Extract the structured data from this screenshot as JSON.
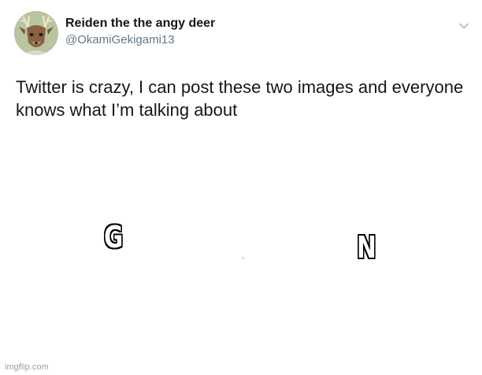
{
  "tweet": {
    "author": {
      "display_name": "Reiden the the angy deer",
      "handle": "@OkamiGekigami13",
      "avatar_icon": "deer-avatar-icon"
    },
    "menu_icon": "chevron-down-icon",
    "text": "Twitter is crazy, I can post these two images and everyone knows what I’m talking about"
  },
  "overlay": {
    "left_letter": "G",
    "right_letter": "N"
  },
  "watermark": "imgflip.com",
  "colors": {
    "text_primary": "#14171a",
    "text_secondary": "#657786",
    "avatar_background": "#b9c4a0"
  }
}
